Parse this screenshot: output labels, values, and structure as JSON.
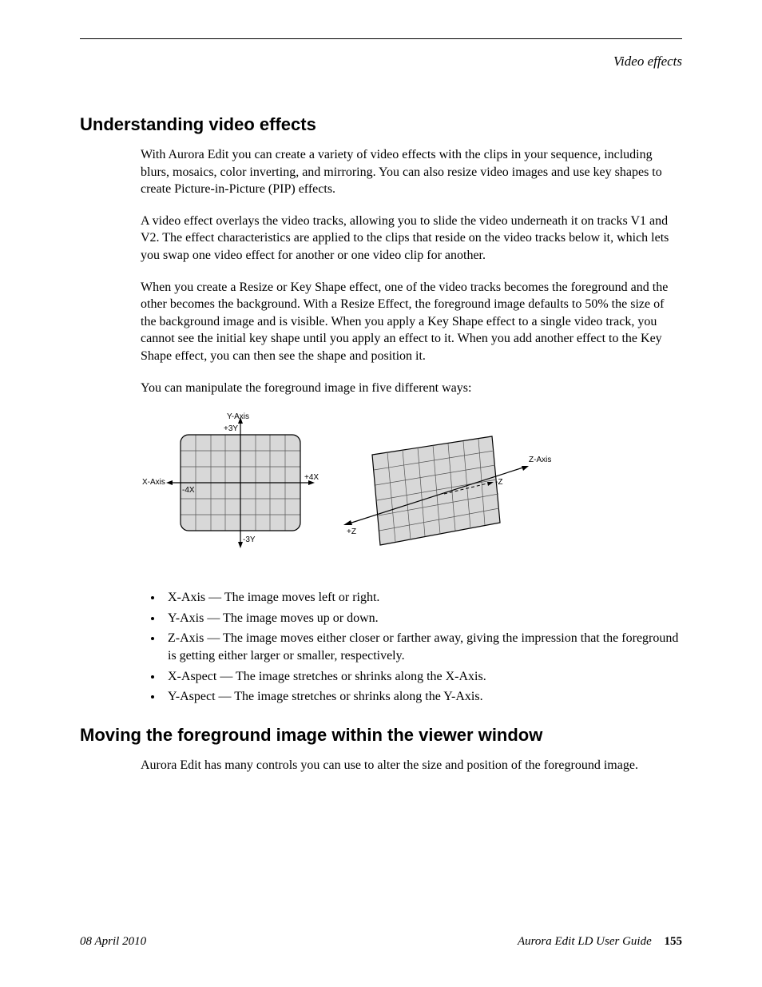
{
  "header": {
    "running": "Video effects"
  },
  "section1": {
    "title": "Understanding video effects",
    "p1": "With Aurora Edit you can create a variety of video effects with the clips in your sequence, including blurs, mosaics, color inverting, and mirroring. You can also resize video images and use key shapes to create Picture-in-Picture (PIP) effects.",
    "p2": "A video effect overlays the video tracks, allowing you to slide the video underneath it on tracks V1 and V2. The effect characteristics are applied to the clips that reside on the video tracks below it, which lets you swap one video effect for another or one video clip for another.",
    "p3": "When you create a Resize or Key Shape effect, one of the video tracks becomes the foreground and the other becomes the background. With a Resize Effect, the foreground image defaults to 50% the size of the background image and is visible. When you apply a Key Shape effect to a single video track, you cannot see the initial key shape until you apply an effect to it. When you add another effect to the Key Shape effect, you can then see the shape and position it.",
    "p4": "You can manipulate the foreground image in five different ways:",
    "bullets": [
      "X-Axis — The image moves left or right.",
      "Y-Axis — The image moves up or down.",
      "Z-Axis — The image moves either closer or farther away, giving the impression that the foreground is getting either larger or smaller, respectively.",
      "X-Aspect — The image stretches or shrinks along the X-Axis.",
      "Y-Aspect — The image stretches or shrinks along the Y-Axis."
    ]
  },
  "diagram": {
    "labels": {
      "yaxis": "Y-Axis",
      "plus3y": "+3Y",
      "minus3y": "-3Y",
      "xaxis": "X-Axis",
      "plus4x": "+4X",
      "minus4x": "-4X",
      "zaxis": "Z-Axis",
      "plusz": "+Z",
      "minusz": "-Z"
    }
  },
  "section2": {
    "title": "Moving the foreground image within the viewer window",
    "p1": "Aurora Edit has many controls you can use to alter the size and position of the foreground image."
  },
  "footer": {
    "date": "08 April 2010",
    "book": "Aurora Edit LD User Guide",
    "page": "155"
  }
}
